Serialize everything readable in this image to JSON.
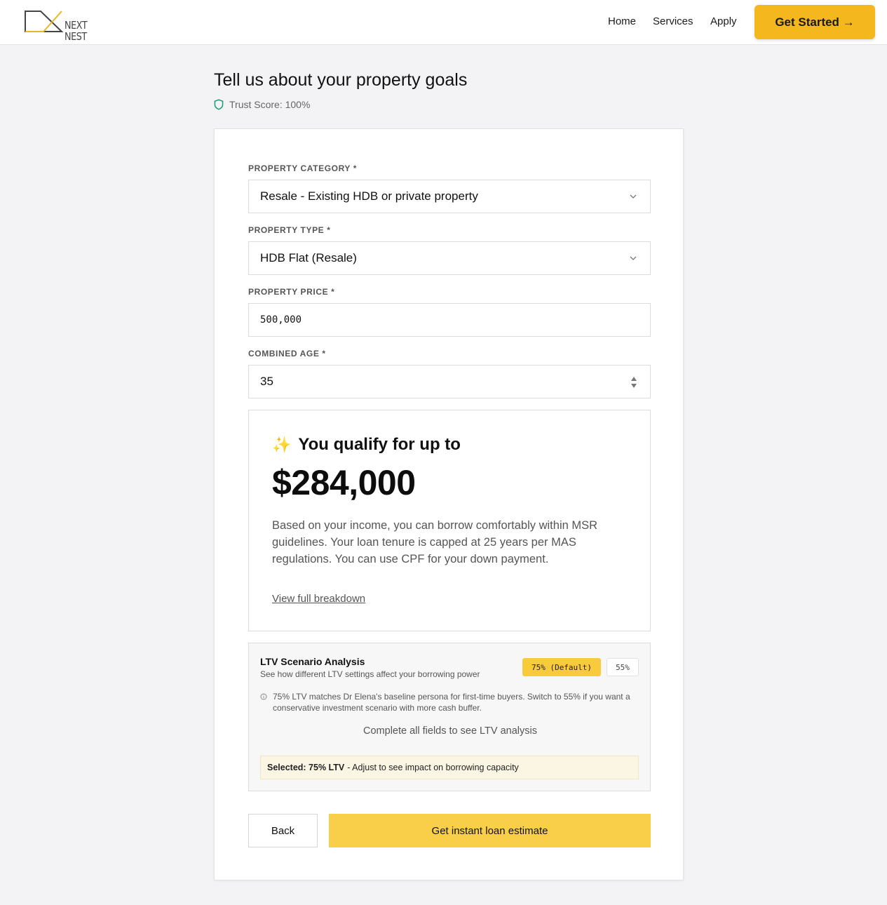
{
  "brand": {
    "logo_line1": "NEXT",
    "logo_line2": "NEST"
  },
  "nav": {
    "items": [
      "Home",
      "Services",
      "Apply"
    ],
    "cta_label": "Get Started →"
  },
  "header": {
    "title": "Tell us about your property goals",
    "trust_score": "Trust Score: 100%"
  },
  "form": {
    "property_category": {
      "label": "PROPERTY CATEGORY *",
      "value": "Resale - Existing HDB or private property"
    },
    "property_type": {
      "label": "PROPERTY TYPE *",
      "value": "HDB Flat (Resale)"
    },
    "property_price": {
      "label": "PROPERTY PRICE *",
      "value": "500,000"
    },
    "combined_age": {
      "label": "COMBINED AGE *",
      "value": "35"
    }
  },
  "qualify": {
    "emoji": "✨",
    "heading": "You qualify for up to",
    "amount": "$284,000",
    "description": "Based on your income, you can borrow comfortably within MSR guidelines. Your loan tenure is capped at 25 years per MAS regulations. You can use CPF for your down payment.",
    "link": "View full breakdown"
  },
  "ltv": {
    "title": "LTV Scenario Analysis",
    "subtitle": "See how different LTV settings affect your borrowing power",
    "options": [
      "75% (Default)",
      "55%"
    ],
    "selected_option": "75% (Default)",
    "note": "75% LTV matches Dr Elena's baseline persona for first-time buyers. Switch to 55% if you want a conservative investment scenario with more cash buffer.",
    "empty_message": "Complete all fields to see LTV analysis",
    "selected_label": "Selected: 75% LTV",
    "selected_hint": "- Adjust to see impact on borrowing capacity"
  },
  "actions": {
    "back": "Back",
    "submit": "Get instant loan estimate"
  },
  "colors": {
    "accent": "#f5b71e",
    "submit": "#f9cf4a",
    "trust_icon": "#1aa37a",
    "background": "#f3f3f6"
  }
}
